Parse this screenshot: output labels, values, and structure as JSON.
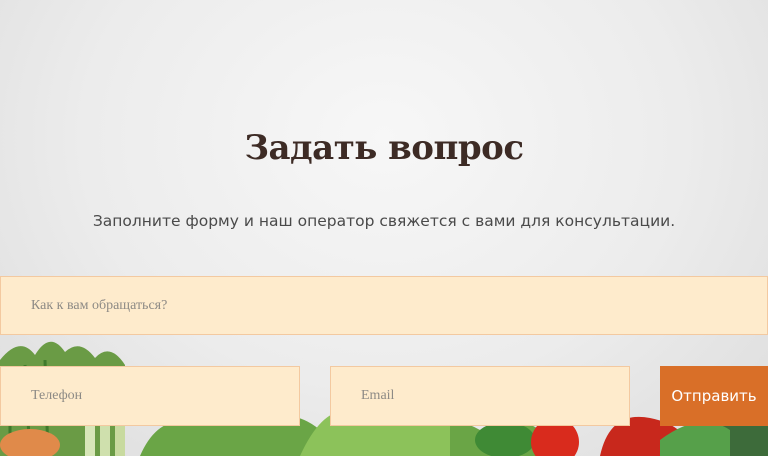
{
  "form": {
    "title": "Задать вопрос",
    "subtitle": "Заполните форму и наш оператор свяжется с вами для консультации.",
    "name_placeholder": "Как к вам обращаться?",
    "phone_placeholder": "Телефон",
    "email_placeholder": "Email",
    "submit_label": "Отправить"
  },
  "colors": {
    "field_bg": "#feebcc",
    "button_bg": "#d96f28",
    "title": "#3d2b25"
  }
}
